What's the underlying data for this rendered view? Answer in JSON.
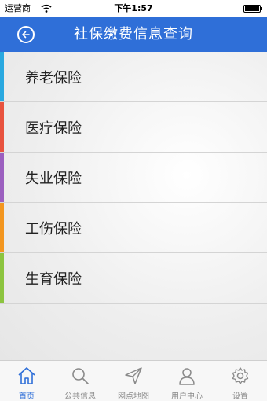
{
  "status_bar": {
    "carrier": "运营商",
    "time": "下午1:57",
    "battery_level": 1.0
  },
  "nav": {
    "title": "社保缴费信息查询",
    "back_icon": "back-arrow-circle-icon"
  },
  "list": {
    "items": [
      {
        "label": "养老保险",
        "accent": "#29a8e0"
      },
      {
        "label": "医疗保险",
        "accent": "#e8533f"
      },
      {
        "label": "失业保险",
        "accent": "#9b5fbf"
      },
      {
        "label": "工伤保险",
        "accent": "#f3961f"
      },
      {
        "label": "生育保险",
        "accent": "#8cc43f"
      }
    ]
  },
  "tabs": {
    "active_color": "#2f6fd8",
    "items": [
      {
        "label": "首页",
        "icon": "home-icon",
        "active": true
      },
      {
        "label": "公共信息",
        "icon": "search-icon",
        "active": false
      },
      {
        "label": "网点地图",
        "icon": "navigation-arrow-icon",
        "active": false
      },
      {
        "label": "用户中心",
        "icon": "user-icon",
        "active": false
      },
      {
        "label": "设置",
        "icon": "gear-icon",
        "active": false
      }
    ]
  }
}
